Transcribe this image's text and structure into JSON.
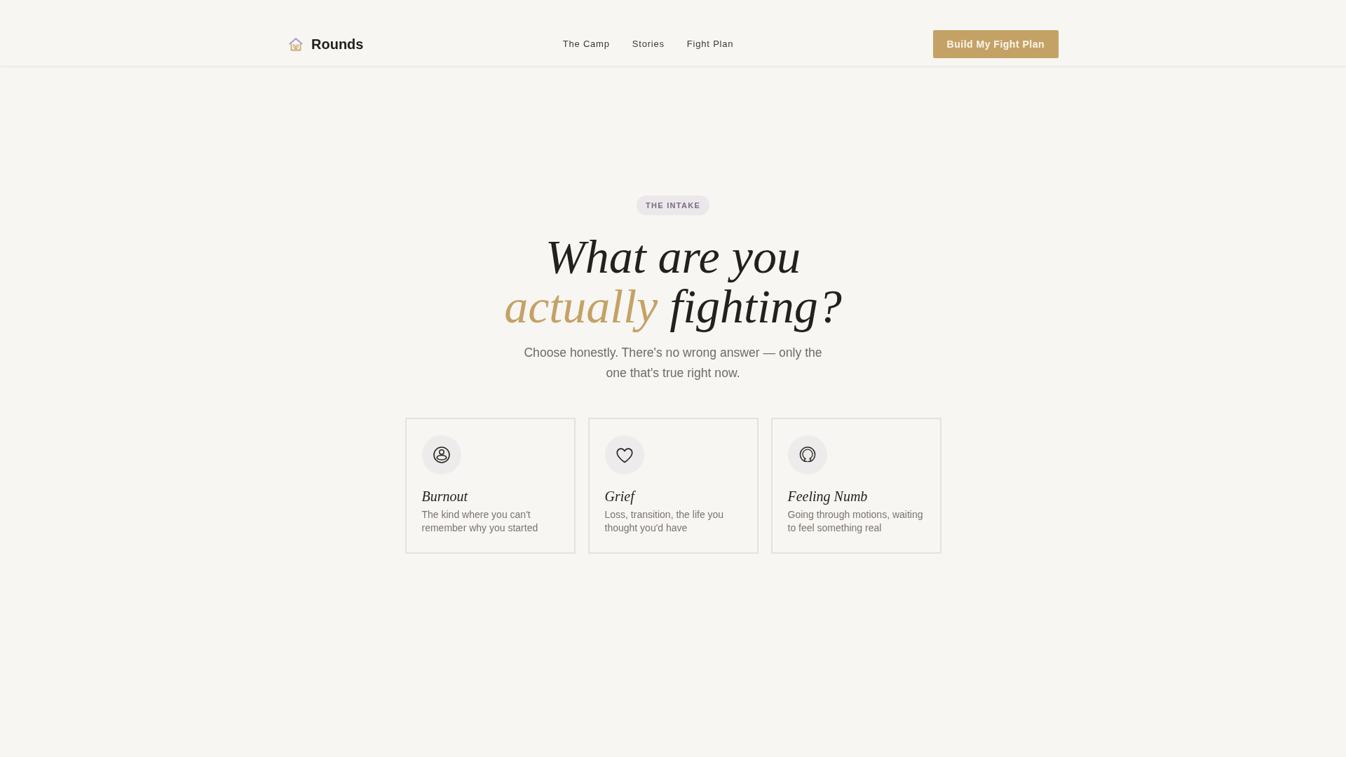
{
  "header": {
    "brand": "Rounds",
    "nav": [
      "The Camp",
      "Stories",
      "Fight Plan"
    ],
    "cta": "Build My Fight Plan"
  },
  "hero": {
    "badge": "THE INTAKE",
    "heading": {
      "line_1": "What are you",
      "accent": "actually",
      "rest": "fighting?"
    },
    "subtitle": "Choose honestly. There's no wrong answer — only the one that's true right now."
  },
  "options": [
    {
      "kind": "burnout",
      "title": "Burnout",
      "description": "The kind where you can't remember why you started"
    },
    {
      "kind": "grief",
      "title": "Grief",
      "description": "Loss, transition, the life you thought you'd have"
    },
    {
      "kind": "numb",
      "title": "Feeling Numb",
      "description": "Going through motions, waiting to feel something real"
    }
  ]
}
